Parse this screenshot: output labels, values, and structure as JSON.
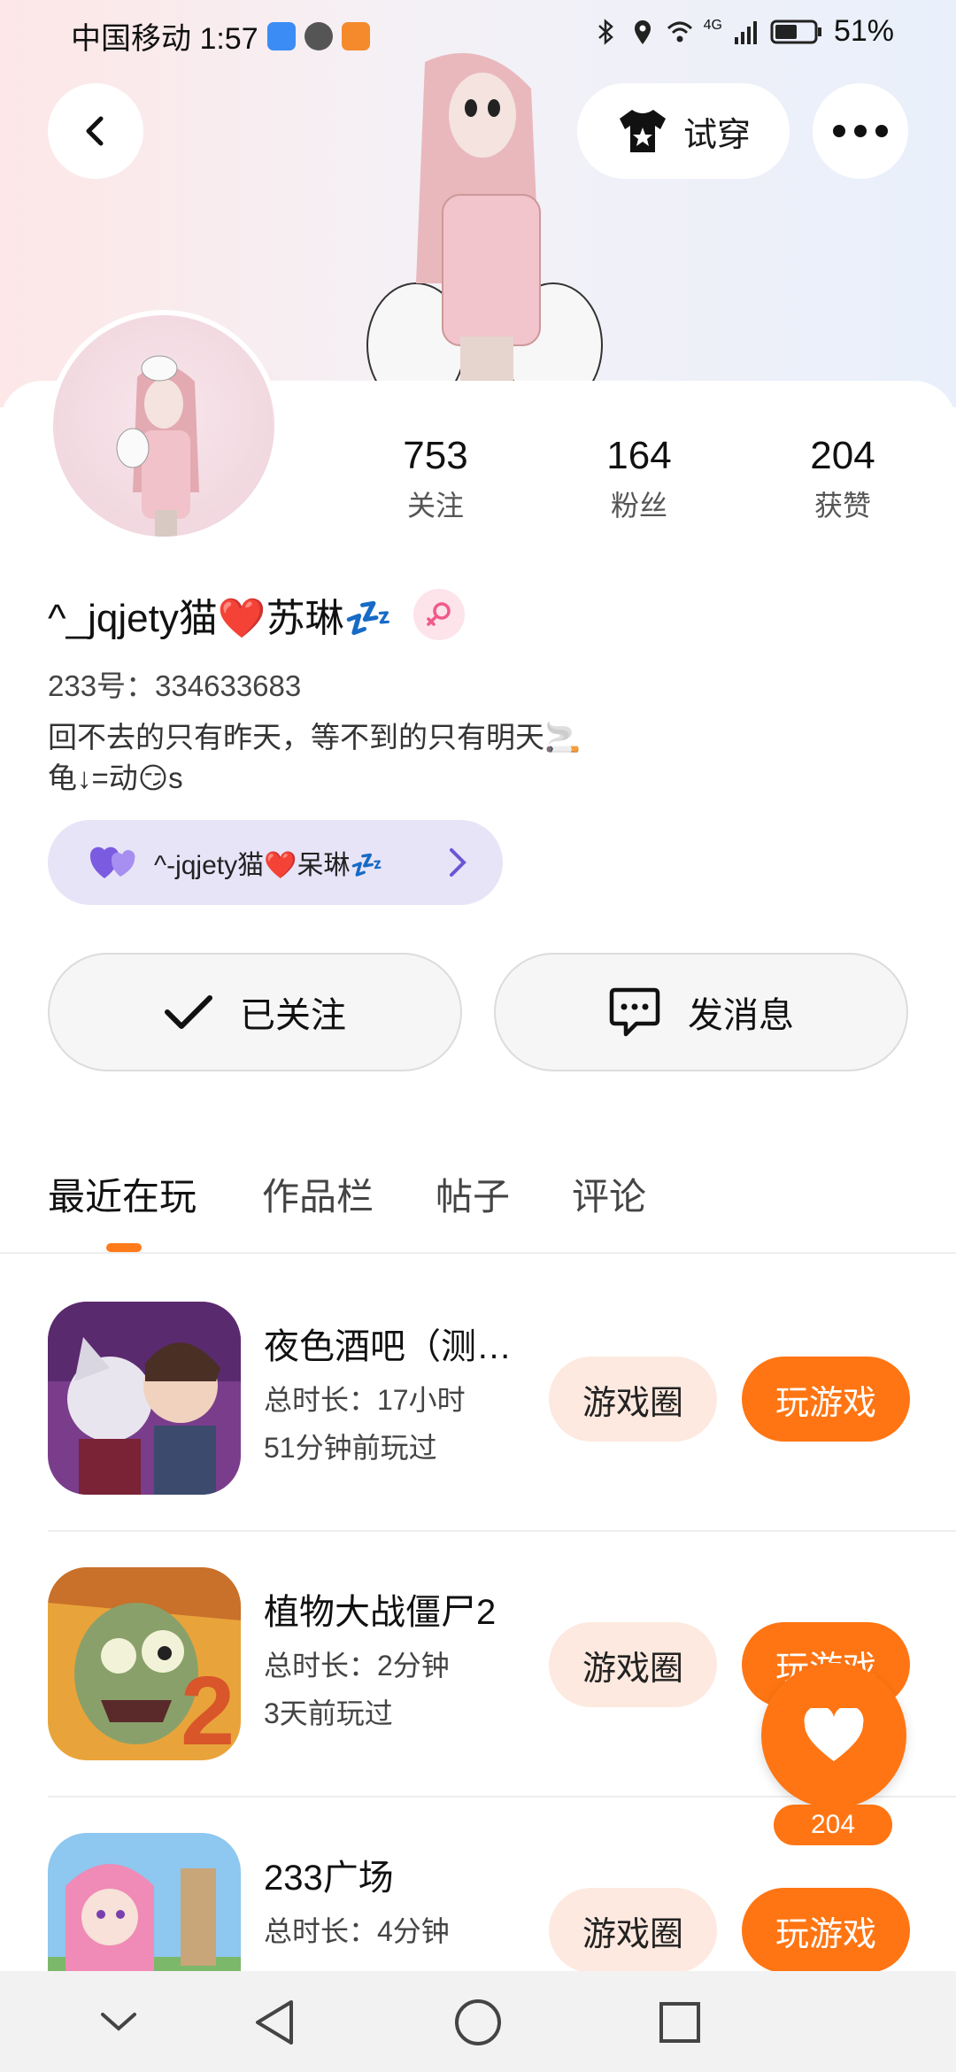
{
  "status_bar": {
    "carrier_time": "中国移动 1:57",
    "battery": "51%",
    "network": "4G"
  },
  "header": {
    "try_on_label": "试穿"
  },
  "profile": {
    "stats": [
      {
        "value": "753",
        "label": "关注"
      },
      {
        "value": "164",
        "label": "粉丝"
      },
      {
        "value": "204",
        "label": "获赞"
      }
    ],
    "username": "^_jqjety猫❤️苏琳💤",
    "uid": "233号：334633683",
    "bio_line1": "回不去的只有昨天，等不到的只有明天🚬",
    "bio_line2": "龟↓=动😏s",
    "cp_name": "^-jqjety猫❤️呆琳💤"
  },
  "actions": {
    "followed_label": "已关注",
    "message_label": "发消息"
  },
  "tabs": [
    "最近在玩",
    "作品栏",
    "帖子",
    "评论"
  ],
  "games": [
    {
      "name": "夜色酒吧（测…",
      "duration": "总时长：17小时",
      "last_played": "51分钟前玩过",
      "circle_label": "游戏圈",
      "play_label": "玩游戏"
    },
    {
      "name": "植物大战僵尸2",
      "duration": "总时长：2分钟",
      "last_played": "3天前玩过",
      "circle_label": "游戏圈",
      "play_label": "玩游戏"
    },
    {
      "name": "233广场",
      "duration": "总时长：4分钟",
      "last_played": "",
      "circle_label": "游戏圈",
      "play_label": "玩游戏"
    }
  ],
  "like_fab": {
    "count": "204"
  },
  "colors": {
    "accent": "#ff7513",
    "pill_bg": "#e7e4f8",
    "circle_btn_bg": "#fde9df"
  },
  "icons": [
    "back-arrow-icon",
    "tshirt-icon",
    "more-dots-icon",
    "female-icon",
    "hearts-icon",
    "chevron-right-icon",
    "check-icon",
    "message-icon",
    "heart-icon",
    "nav-back-icon",
    "nav-home-icon",
    "nav-recents-icon",
    "nav-down-icon"
  ]
}
